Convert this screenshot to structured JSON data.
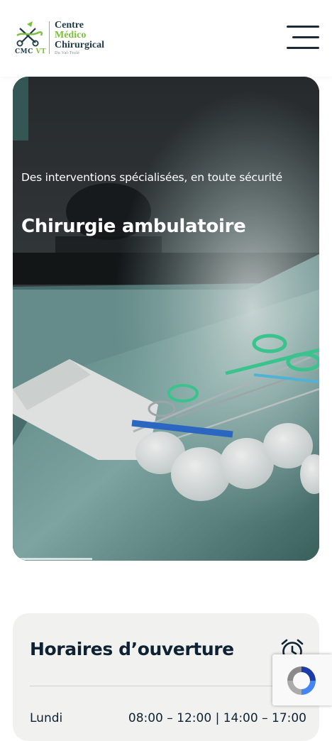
{
  "header": {
    "logo": {
      "abbreviation_left": "CMC",
      "abbreviation_right": "VT",
      "line1": "Centre",
      "line2": "Médico",
      "line3": "Chirurgical",
      "line4": "Du Val-Tezlé"
    },
    "menu_icon": "hamburger-menu-icon"
  },
  "hero": {
    "subtitle": "Des interventions spécialisées, en toute sécurité",
    "title": "Chirurgie ambulatoire",
    "progress": 0.26
  },
  "hours": {
    "title": "Horaires d’ouverture",
    "icon": "alarm-clock-icon",
    "rows": [
      {
        "day": "Lundi",
        "time": "08:00 – 12:00 | 14:00 – 17:00"
      }
    ]
  },
  "recaptcha": {
    "icon": "recaptcha-icon"
  },
  "colors": {
    "brand_dark": "#1f3a47",
    "brand_green": "#7bbf3a",
    "text": "#0f2233",
    "card_bg": "#f1f2f0"
  }
}
